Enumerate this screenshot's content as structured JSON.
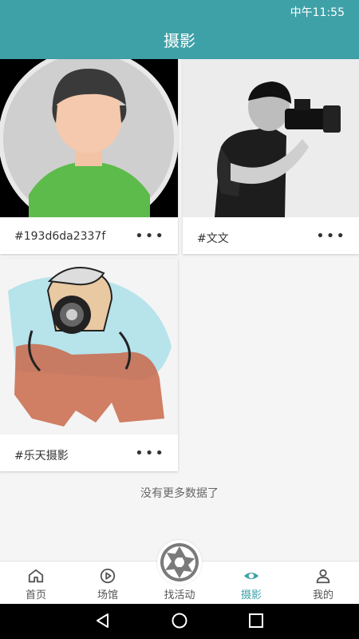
{
  "status": {
    "time": "中午11:55"
  },
  "header": {
    "title": "摄影"
  },
  "cards": [
    {
      "tag": "#193d6da2337f",
      "more": "•••"
    },
    {
      "tag": "#文文",
      "more": "•••"
    },
    {
      "tag": "#乐天摄影",
      "more": "•••"
    }
  ],
  "list_footer": "没有更多数据了",
  "tabs": [
    {
      "label": "首页",
      "icon": "home-icon"
    },
    {
      "label": "场馆",
      "icon": "play-circle-icon"
    },
    {
      "label": "找活动",
      "icon": "aperture-icon"
    },
    {
      "label": "摄影",
      "icon": "eye-icon",
      "active": true
    },
    {
      "label": "我的",
      "icon": "person-icon"
    }
  ],
  "colors": {
    "primary": "#3fa1a8",
    "active_tab": "#3fa1a8"
  }
}
